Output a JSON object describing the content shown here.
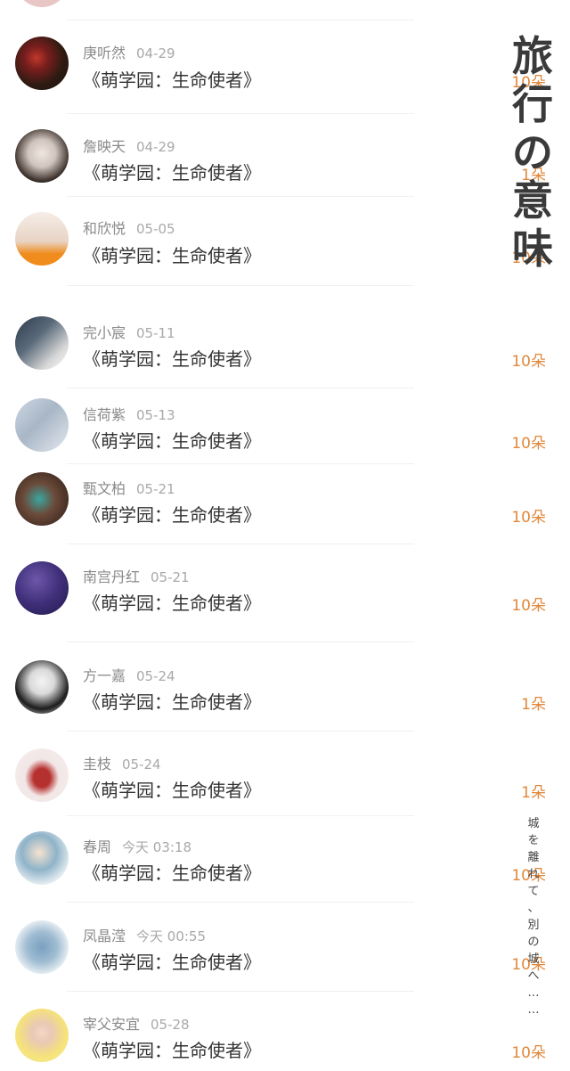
{
  "list": [
    {
      "name": "庚听然",
      "date": "04-29",
      "title": "《萌学园：生命使者》",
      "count": "10朵"
    },
    {
      "name": "詹映天",
      "date": "04-29",
      "title": "《萌学园：生命使者》",
      "count": "1朵"
    },
    {
      "name": "和欣悦",
      "date": "05-05",
      "title": "《萌学园：生命使者》",
      "count": "10朵"
    },
    {
      "name": "完小宸",
      "date": "05-11",
      "title": "《萌学园：生命使者》",
      "count": "10朵"
    },
    {
      "name": "信荷紫",
      "date": "05-13",
      "title": "《萌学园：生命使者》",
      "count": "10朵"
    },
    {
      "name": "甄文柏",
      "date": "05-21",
      "title": "《萌学园：生命使者》",
      "count": "10朵"
    },
    {
      "name": "南宫丹红",
      "date": "05-21",
      "title": "《萌学园：生命使者》",
      "count": "10朵"
    },
    {
      "name": "方一嘉",
      "date": "05-24",
      "title": "《萌学园：生命使者》",
      "count": "1朵"
    },
    {
      "name": "圭枝",
      "date": "05-24",
      "title": "《萌学园：生命使者》",
      "count": "1朵"
    },
    {
      "name": "春周",
      "date": "今天 03:18",
      "title": "《萌学园：生命使者》",
      "count": "10朵"
    },
    {
      "name": "凤晶滢",
      "date": "今天 00:55",
      "title": "《萌学园：生命使者》",
      "count": "10朵"
    },
    {
      "name": "宰父安宜",
      "date": "05-28",
      "title": "《萌学园：生命使者》",
      "count": "10朵"
    }
  ],
  "side": {
    "title_chars": [
      "旅",
      "行",
      "の",
      "意",
      "味"
    ],
    "subtitle_chars": [
      "城",
      "を",
      "離",
      "れ",
      "て",
      "、",
      "別",
      "の",
      "城",
      "へ",
      "…",
      "…"
    ]
  },
  "colors": {
    "accent": "#e0883a",
    "name": "#8a8a8a",
    "title": "#333333"
  }
}
